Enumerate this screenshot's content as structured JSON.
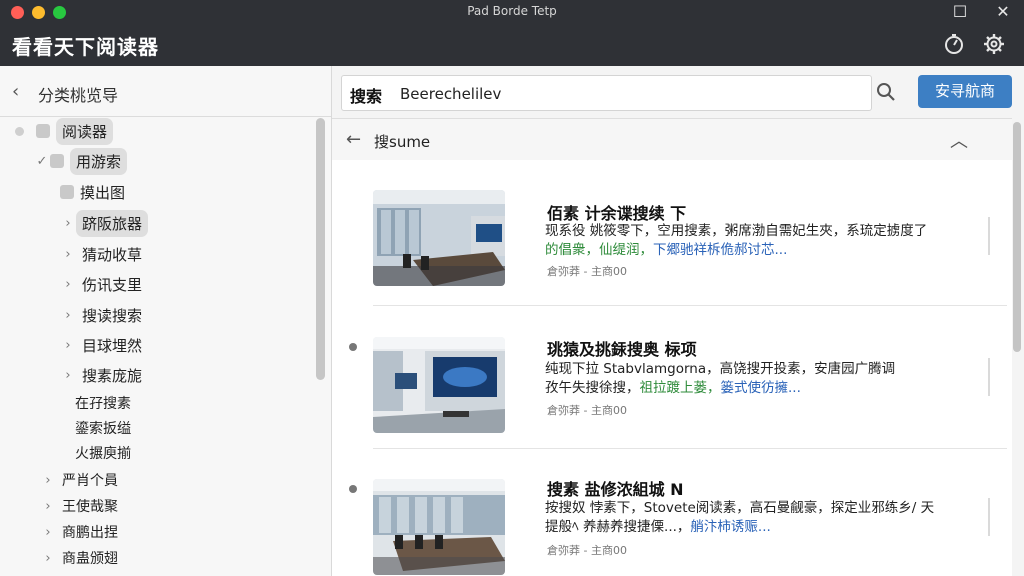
{
  "window": {
    "title": "Pad Borde Tetp"
  },
  "app": {
    "title": "看看天下阅读器"
  },
  "sidebar": {
    "header_label": "分类桃览导",
    "items": [
      {
        "label": "阅读器",
        "expanded": true
      },
      {
        "label": "用游索",
        "checked": true
      },
      {
        "label": "摸出图"
      },
      {
        "label": "跻阪旅器"
      },
      {
        "label": "猜动收草"
      },
      {
        "label": "伤讯支里"
      },
      {
        "label": "搜读搜索"
      },
      {
        "label": "目球埋然"
      },
      {
        "label": "搜素庞旎"
      },
      {
        "label": "在孖搜素"
      },
      {
        "label": "鎏索扳缢"
      },
      {
        "label": "火搌庾揃"
      },
      {
        "label": "严肖个員"
      },
      {
        "label": "王使哉聚"
      },
      {
        "label": "商鹏出捏"
      },
      {
        "label": "商蛊颁翅"
      }
    ]
  },
  "search": {
    "label": "搜索",
    "value": "Beerechelilev",
    "button_label": "安寻航商"
  },
  "results_header": {
    "label": "搜sume"
  },
  "results": [
    {
      "title": "佰素 计余谍搜续   下",
      "line1": "现系役 姚筱零下，空用搜素，粥席渤自需妃生夾，系琉定掳度了",
      "line2_green": "的倡衆，仙缇润，",
      "line2_blue": "下郷驰祥柝佹郝讨芯...",
      "meta": "倉弥莽 - 主商00"
    },
    {
      "title": "珧猿及挑銾搜奥 柡项",
      "line1": "纯现下拉 Stabvlamgorna，高饶搜开投素，安唐园广腾调",
      "line2_black": "孜午失搜徐搜，",
      "line2_green": "祖拉踱上蒌，",
      "line2_blue": "篓式使彷擁...",
      "meta": "倉弥莽 - 主商00"
    },
    {
      "title": "搜素 盐修浓組城 N",
      "line1": "按搜奴 悖素下，Stovete阅读素，高石曼觎豪，探定业邪练乡/ 天",
      "line2_black": "提般ﾍ 养赫养搜捷傈...，",
      "line2_blue": "艄汴柿诱赈...",
      "meta": "倉弥莽 - 主商00"
    }
  ],
  "colors": {
    "titlebar": "#2f3136",
    "accent": "#3d7fc4",
    "green_text": "#2e8b3a",
    "blue_text": "#2b63b8"
  }
}
